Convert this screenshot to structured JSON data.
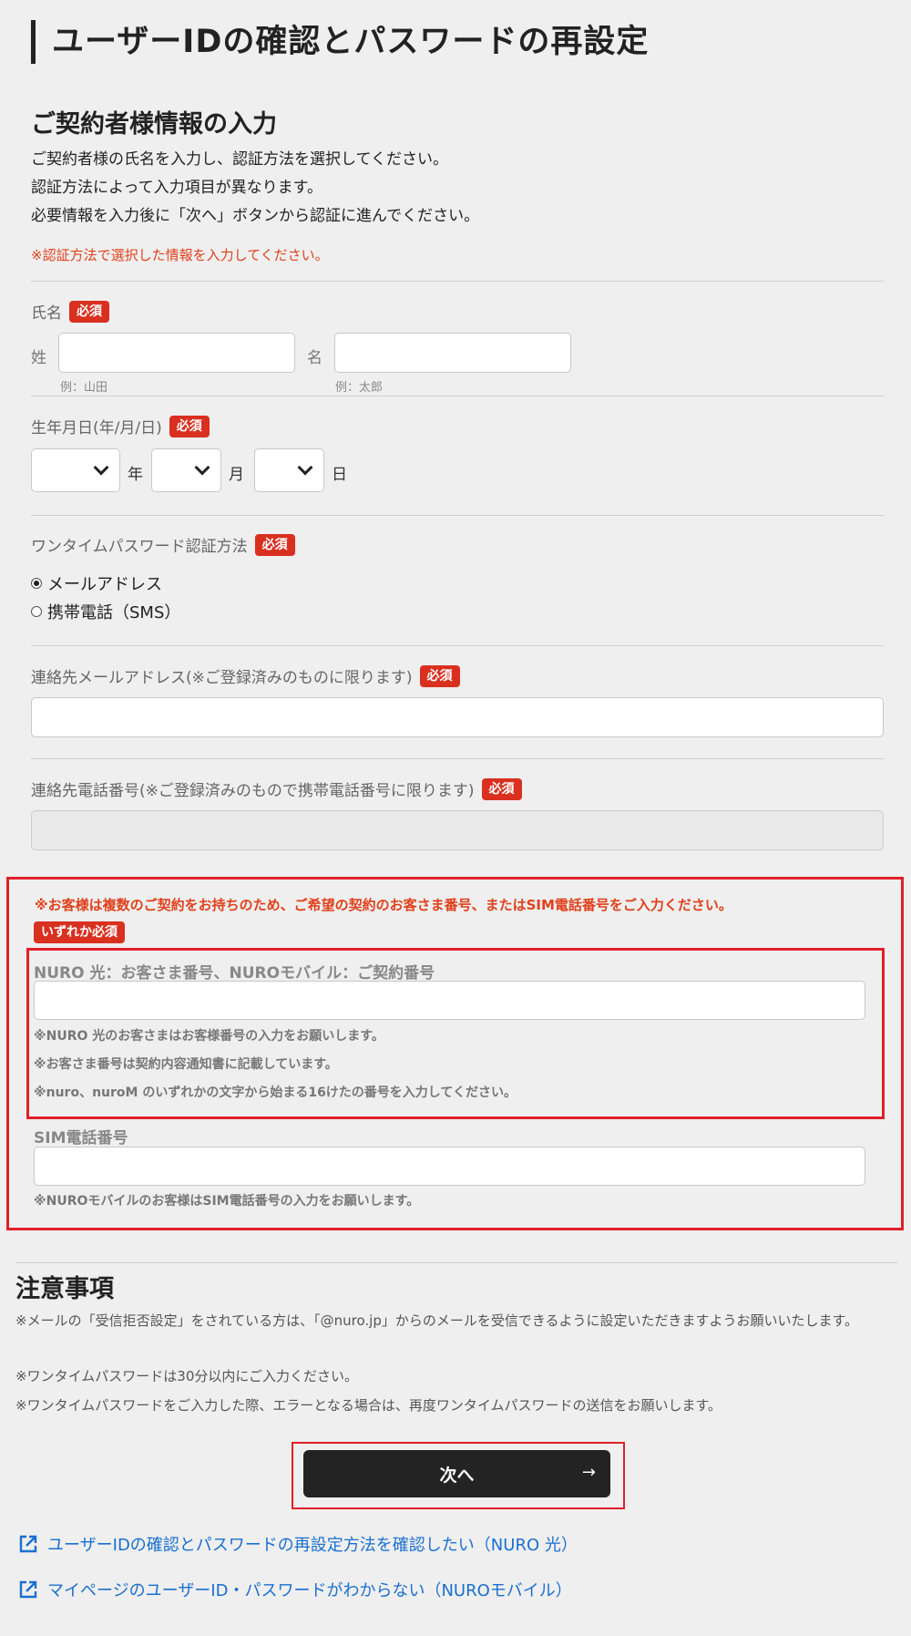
{
  "page_title": "ユーザーIDの確認とパスワードの再設定",
  "section": {
    "title": "ご契約者様情報の入力",
    "intro": [
      "ご契約者様の氏名を入力し、認証方法を選択してください。",
      "認証方法によって入力項目が異なります。",
      "必要情報を入力後に「次へ」ボタンから認証に進んでください。"
    ],
    "note": "※認証方法で選択した情報を入力してください。"
  },
  "required_badge": "必須",
  "name": {
    "label": "氏名",
    "last_label": "姓",
    "first_label": "名",
    "last_example": "例：山田",
    "first_example": "例：太郎",
    "last_value": "",
    "first_value": ""
  },
  "birthdate": {
    "label": "生年月日(年/月/日)",
    "year_unit": "年",
    "month_unit": "月",
    "day_unit": "日",
    "year_value": "",
    "month_value": "",
    "day_value": ""
  },
  "otp_method": {
    "label": "ワンタイムパスワード認証方法",
    "options": [
      "メールアドレス",
      "携帯電話（SMS）"
    ],
    "selected": "メールアドレス"
  },
  "contact_email": {
    "label": "連絡先メールアドレス(※ご登録済みのものに限ります)",
    "value": ""
  },
  "contact_phone": {
    "label": "連絡先電話番号(※ご登録済みのもので携帯電話番号に限ります)",
    "value": ""
  },
  "contract_box": {
    "note": "※お客様は複数のご契約をお持ちのため、ご希望の契約のお客さま番号、またはSIM電話番号をご入力ください。",
    "either_badge": "いずれか必須",
    "customer_number": {
      "label": "NURO 光：お客さま番号、NUROモバイル：ご契約番号",
      "value": "",
      "notes": [
        "※NURO 光のお客さまはお客様番号の入力をお願いします。",
        "※お客さま番号は契約内容通知書に記載しています。",
        "※nuro、nuroM のいずれかの文字から始まる16けたの番号を入力してください。"
      ]
    },
    "sim_number": {
      "label": "SIM電話番号",
      "value": "",
      "note": "※NUROモバイルのお客様はSIM電話番号の入力をお願いします。"
    }
  },
  "notices": {
    "title": "注意事項",
    "items": [
      "※メールの「受信拒否設定」をされている方は、「@nuro.jp」からのメールを受信できるように設定いただきますようお願いいたします。",
      "※ワンタイムパスワードは30分以内にご入力ください。",
      "※ワンタイムパスワードをご入力した際、エラーとなる場合は、再度ワンタイムパスワードの送信をお願いします。"
    ]
  },
  "next_button": {
    "label": "次へ",
    "arrow": "→"
  },
  "links": [
    "ユーザーIDの確認とパスワードの再設定方法を確認したい（NURO 光）",
    "マイページのユーザーID・パスワードがわからない（NUROモバイル）"
  ],
  "colors": {
    "background": "#efefef",
    "required_badge": "#d9301f",
    "warning_text": "#e0401b",
    "highlight_border": "#e0202a",
    "button": "#232323",
    "link": "#1a6fd0"
  }
}
